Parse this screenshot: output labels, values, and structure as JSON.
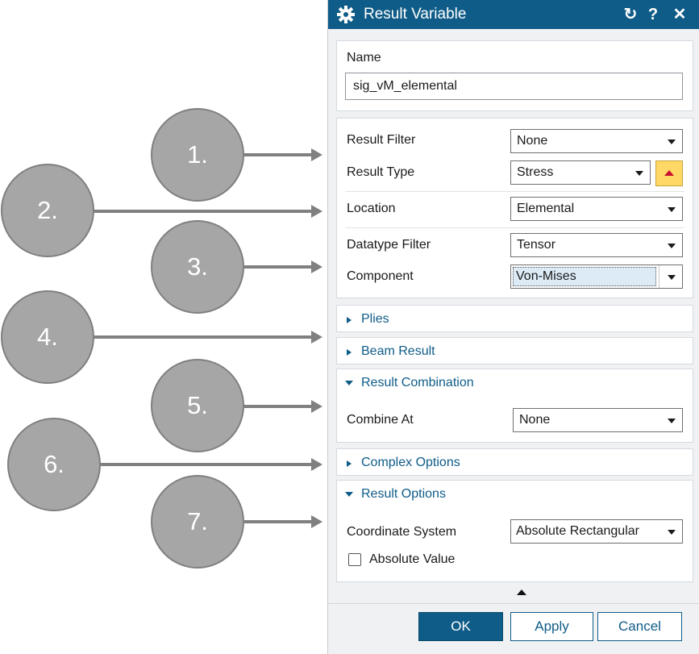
{
  "callouts": [
    "1.",
    "2.",
    "3.",
    "4.",
    "5.",
    "6.",
    "7."
  ],
  "dialog": {
    "title": "Result Variable",
    "name_label": "Name",
    "name_value": "sig_vM_elemental",
    "result_filter_label": "Result Filter",
    "result_filter_value": "None",
    "result_type_label": "Result Type",
    "result_type_value": "Stress",
    "location_label": "Location",
    "location_value": "Elemental",
    "datatype_filter_label": "Datatype Filter",
    "datatype_filter_value": "Tensor",
    "component_label": "Component",
    "component_value": "Von-Mises",
    "plies_label": "Plies",
    "beam_result_label": "Beam Result",
    "result_combination_label": "Result Combination",
    "combine_at_label": "Combine At",
    "combine_at_value": "None",
    "complex_options_label": "Complex Options",
    "result_options_label": "Result Options",
    "coordinate_system_label": "Coordinate System",
    "coordinate_system_value": "Absolute Rectangular",
    "absolute_value_label": "Absolute Value",
    "absolute_value_checked": false,
    "ok_label": "OK",
    "apply_label": "Apply",
    "cancel_label": "Cancel"
  },
  "colors": {
    "titlebar": "#0f5c88",
    "accent": "#0f5c88",
    "warning": "#ffd866"
  },
  "icons": [
    "gear-icon",
    "reset-icon",
    "help-icon",
    "close-icon",
    "expand-up-icon",
    "collapse-up-arrow-icon"
  ]
}
